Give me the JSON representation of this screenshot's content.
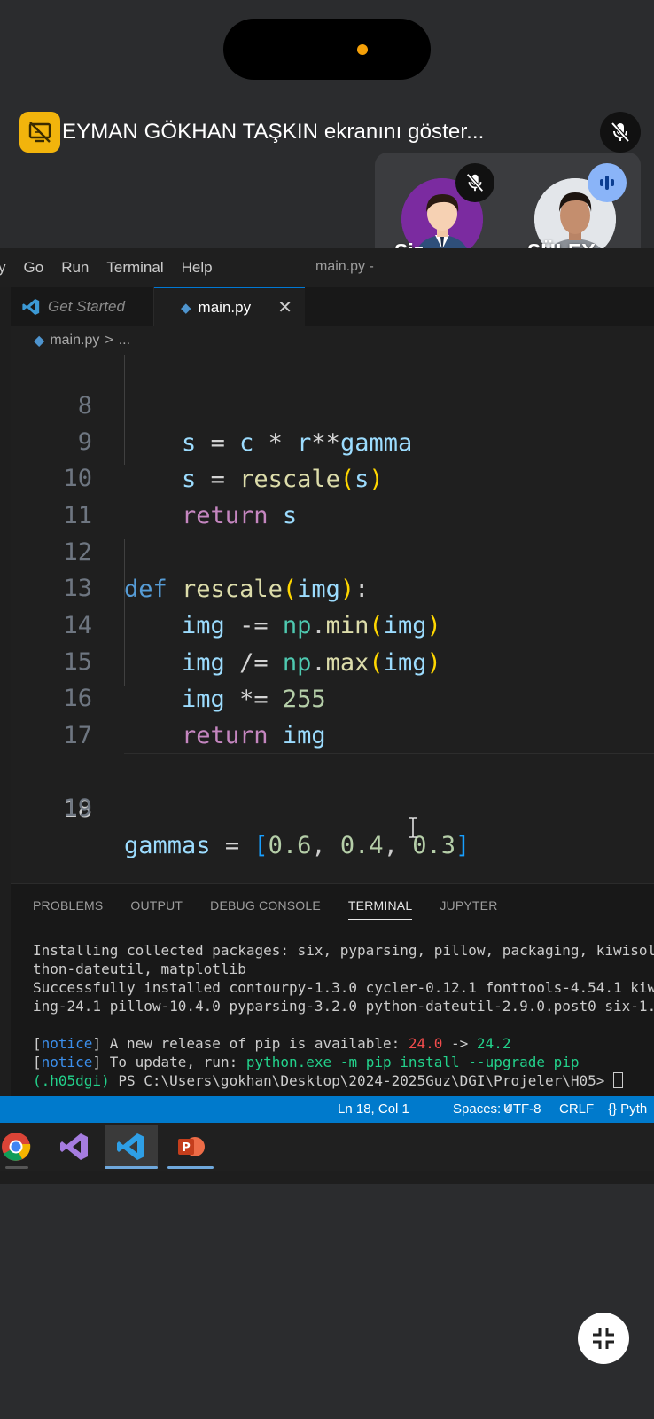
{
  "share_banner": {
    "text": "EYMAN GÖKHAN TAŞKIN ekranını göster..."
  },
  "participants": [
    {
      "name": "Siz",
      "status": "muted"
    },
    {
      "name": "SÜLEY...",
      "status": "speaking"
    }
  ],
  "vscode": {
    "menu": [
      "y",
      "Go",
      "Run",
      "Terminal",
      "Help"
    ],
    "window_title": "main.py -",
    "tabs": [
      {
        "label": "Get Started",
        "active": false
      },
      {
        "label": "main.py",
        "active": true,
        "close": "✕"
      }
    ],
    "breadcrumb": {
      "file": "main.py",
      "sep": ">",
      "rest": "..."
    },
    "code": {
      "line_numbers": [
        "8",
        "9",
        "10",
        "11",
        "12",
        "13",
        "14",
        "15",
        "16",
        "17",
        "18",
        "19"
      ],
      "current_line": "18"
    },
    "panel": {
      "tabs": [
        "PROBLEMS",
        "OUTPUT",
        "DEBUG CONSOLE",
        "TERMINAL",
        "JUPYTER"
      ],
      "active_tab": "TERMINAL",
      "terminal": {
        "l1": "Installing collected packages: six, pyparsing, pillow, packaging, kiwisol",
        "l2": "thon-dateutil, matplotlib",
        "l3": "Successfully installed contourpy-1.3.0 cycler-0.12.1 fonttools-4.54.1 kiw",
        "l4": "ing-24.1 pillow-10.4.0 pyparsing-3.2.0 python-dateutil-2.9.0.post0 six-1.",
        "n1_tag": "notice",
        "n1_text": " A new release of pip is available: ",
        "n1_old": "24.0",
        "n1_arrow": " -> ",
        "n1_new": "24.2",
        "n2_tag": "notice",
        "n2_text": " To update, run: ",
        "n2_cmd": "python.exe -m pip install --upgrade pip",
        "prompt_env": "(.h05dgi)",
        "prompt_path": " PS C:\\Users\\gokhan\\Desktop\\2024-2025Guz\\DGI\\Projeler\\H05> "
      }
    },
    "statusbar": {
      "position": "Ln 18, Col 1",
      "spaces": "Spaces: 4",
      "encoding": "UTF-8",
      "eol": "CRLF",
      "language": "{} Pyth"
    }
  },
  "taskbar": [
    "chrome-icon",
    "visual-studio-icon",
    "vscode-icon",
    "powerpoint-icon"
  ],
  "colors": {
    "accent": "#007acc",
    "banner_icon": "#f2b40c",
    "speaking": "#8ab4f8"
  }
}
